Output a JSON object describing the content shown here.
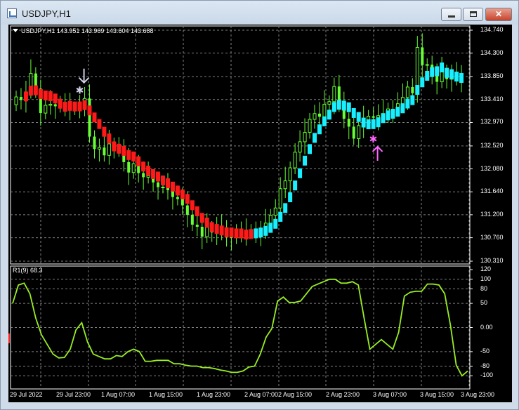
{
  "window": {
    "title": "USDJPY,H1",
    "buttons": {
      "minimize": "minimize",
      "maximize": "maximize",
      "close": "close"
    }
  },
  "colors": {
    "background": "#000000",
    "grid": "#7f7f7f",
    "bull_candle": "#66ff33",
    "bear_candle": "#66ff33",
    "trend_down": "#ff1a1a",
    "trend_up": "#19f0ff",
    "rsi_line": "#99ee22",
    "sell_arrow": "#cfcfe6",
    "buy_arrow": "#ff66ff"
  },
  "main_chart": {
    "header": "USDJPY,H1  143.951 143.969 143.604 143.688",
    "price_labels": [
      "134.740",
      "134.300",
      "133.850",
      "133.410",
      "132.970",
      "132.520",
      "132.080",
      "131.640",
      "131.200",
      "130.760",
      "130.310"
    ],
    "ylim": [
      130.31,
      134.74
    ],
    "markers": [
      {
        "type": "sell-arrow",
        "bar": 13,
        "price": 133.68
      },
      {
        "type": "buy-arrow",
        "bar": 73,
        "price": 132.64
      }
    ]
  },
  "sub_chart": {
    "header": "R1(9) 68.3",
    "level_labels": [
      "120",
      "100",
      "80",
      "50",
      "0.00",
      "-50",
      "-80",
      "-100"
    ]
  },
  "time_axis": [
    "29 Jul 2022",
    "29 Jul 23:00",
    "1 Aug 07:00",
    "1 Aug 15:00",
    "1 Aug 23:00",
    "2 Aug 07:00",
    "2 Aug 15:00",
    "2 Aug 23:00",
    "3 Aug 07:00",
    "3 Aug 15:00",
    "3 Aug 23:00"
  ],
  "chart_data": [
    {
      "type": "candlestick",
      "title": "USDJPY,H1",
      "ylim": [
        130.31,
        134.74
      ],
      "grid": true,
      "ohlc_closes": [
        133.46,
        133.4,
        133.55,
        133.91,
        133.62,
        133.15,
        133.3,
        133.32,
        133.28,
        133.31,
        133.27,
        133.25,
        133.23,
        133.33,
        133.43,
        132.7,
        132.46,
        132.49,
        132.34,
        132.56,
        132.52,
        132.43,
        132.21,
        132.01,
        132.18,
        132.0,
        131.92,
        131.95,
        131.82,
        131.73,
        131.73,
        131.67,
        131.54,
        131.5,
        131.38,
        131.2,
        131.01,
        130.97,
        130.78,
        130.96,
        130.86,
        130.99,
        130.83,
        130.77,
        130.76,
        130.85,
        130.85,
        130.86,
        130.9,
        130.84,
        130.86,
        131.04,
        131.19,
        131.33,
        131.7,
        131.85,
        132.1,
        132.4,
        132.6,
        132.78,
        133.03,
        133.14,
        133.08,
        133.32,
        133.37,
        133.66,
        133.29,
        133.04,
        132.89,
        132.66,
        132.91,
        133.02,
        133.09,
        133.06,
        133.1,
        133.14,
        133.23,
        133.2,
        133.33,
        133.45,
        133.65,
        133.53,
        134.41,
        134.07,
        134.08,
        133.88,
        133.75,
        133.96,
        133.8,
        133.91,
        133.8,
        133.73
      ]
    },
    {
      "type": "line",
      "title": "R1(9) 68.3",
      "ylim": [
        -120,
        120
      ],
      "series": [
        {
          "name": "R1(9)",
          "values": [
            50,
            88,
            92,
            70,
            20,
            -15,
            -35,
            -55,
            -63,
            -62,
            -45,
            -5,
            10,
            -30,
            -55,
            -60,
            -65,
            -65,
            -58,
            -60,
            -50,
            -45,
            -50,
            -70,
            -70,
            -68,
            -68,
            -68,
            -75,
            -75,
            -78,
            -80,
            -80,
            -83,
            -83,
            -85,
            -88,
            -90,
            -93,
            -93,
            -90,
            -82,
            -80,
            -55,
            -20,
            -2,
            55,
            63,
            52,
            52,
            55,
            70,
            85,
            90,
            95,
            100,
            100,
            92,
            92,
            95,
            88,
            20,
            -45,
            -35,
            -25,
            -35,
            -45,
            -10,
            65,
            73,
            75,
            75,
            90,
            90,
            88,
            70,
            5,
            -78,
            -100,
            -90
          ]
        }
      ]
    }
  ]
}
